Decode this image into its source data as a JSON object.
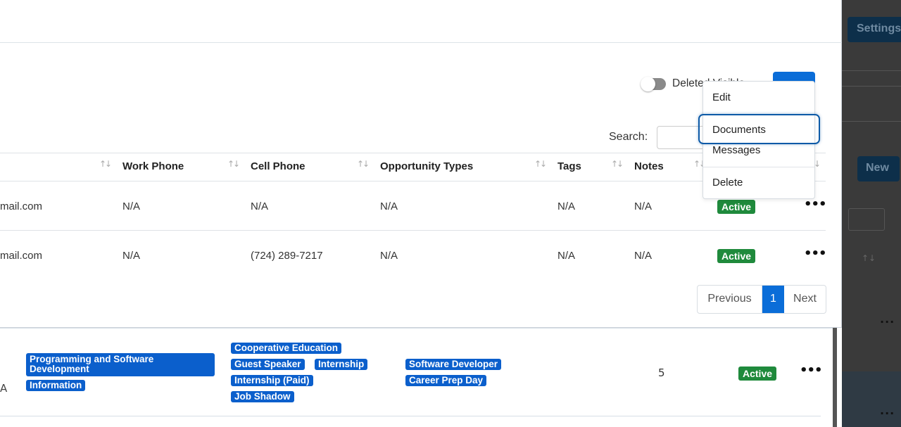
{
  "background": {
    "settings_label": "Settings",
    "new_label": "New"
  },
  "modal": {
    "toggle_label": "Deleted Visible",
    "search_label": "Search:",
    "columns": [
      "Work Phone",
      "Cell Phone",
      "Opportunity Types",
      "Tags",
      "Notes"
    ],
    "rows": [
      {
        "email": "mail.com",
        "work_phone": "N/A",
        "cell_phone": "N/A",
        "opportunity_types": "N/A",
        "tags": "N/A",
        "notes": "N/A",
        "status": "Active"
      },
      {
        "email": "mail.com",
        "work_phone": "N/A",
        "cell_phone": "(724) 289-7217",
        "opportunity_types": "N/A",
        "tags": "N/A",
        "notes": "N/A",
        "status": "Active"
      }
    ],
    "pagination": {
      "previous": "Previous",
      "current": "1",
      "next": "Next"
    }
  },
  "dropdown": {
    "items": [
      "Edit",
      "Documents",
      "Messages",
      "Delete"
    ]
  },
  "lower_row": {
    "left_letter": "A",
    "industries": [
      "Programming and Software Development",
      "Information"
    ],
    "opportunity_types": [
      "Cooperative Education",
      "Guest Speaker",
      "Internship",
      "Internship (Paid)",
      "Job Shadow"
    ],
    "tags": [
      "Software Developer",
      "Career Prep Day"
    ],
    "count": "5",
    "status": "Active"
  },
  "colors": {
    "primary": "#0a6dd8",
    "tag_blue": "#0b5fcc",
    "active_green": "#1f8a3c",
    "focus_ring": "#0d5aa7"
  }
}
